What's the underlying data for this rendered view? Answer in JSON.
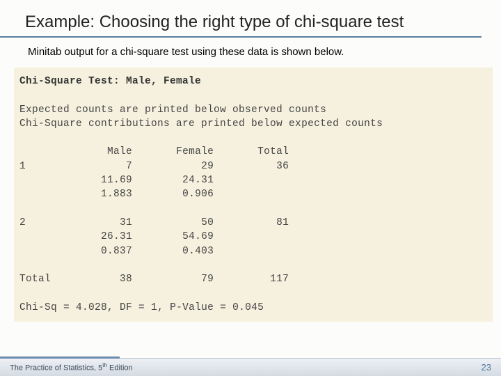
{
  "slide": {
    "title": "Example: Choosing the right type of chi-square test",
    "subtitle": "Minitab output for a chi-square test using these data is shown below."
  },
  "output": {
    "heading": "Chi-Square Test: Male, Female",
    "note1": "Expected counts are printed below observed counts",
    "note2": "Chi-Square contributions are printed below expected counts",
    "columns": [
      "",
      "Male",
      "Female",
      "Total"
    ],
    "rows": [
      {
        "label": "1",
        "observed": [
          7,
          29,
          36
        ],
        "expected": [
          11.69,
          24.31
        ],
        "contrib": [
          1.883,
          0.906
        ]
      },
      {
        "label": "2",
        "observed": [
          31,
          50,
          81
        ],
        "expected": [
          26.31,
          54.69
        ],
        "contrib": [
          0.837,
          0.403
        ]
      }
    ],
    "totals": {
      "label": "Total",
      "values": [
        38,
        79,
        117
      ]
    },
    "summary": {
      "chi_sq": 4.028,
      "df": 1,
      "p_value": 0.045
    }
  },
  "footer": {
    "book_prefix": "The Practice of Statistics, 5",
    "book_suffix": " Edition",
    "th": "th",
    "page": "23"
  },
  "chart_data": {
    "type": "table",
    "title": "Chi-Square Test: Male, Female",
    "columns": [
      "Row",
      "Male",
      "Female",
      "Total"
    ],
    "observed": [
      [
        "1",
        7,
        29,
        36
      ],
      [
        "2",
        31,
        50,
        81
      ],
      [
        "Total",
        38,
        79,
        117
      ]
    ],
    "expected": [
      [
        "1",
        11.69,
        24.31
      ],
      [
        "2",
        26.31,
        54.69
      ]
    ],
    "contributions": [
      [
        "1",
        1.883,
        0.906
      ],
      [
        "2",
        0.837,
        0.403
      ]
    ],
    "statistic": {
      "Chi-Sq": 4.028,
      "DF": 1,
      "P-Value": 0.045
    }
  }
}
